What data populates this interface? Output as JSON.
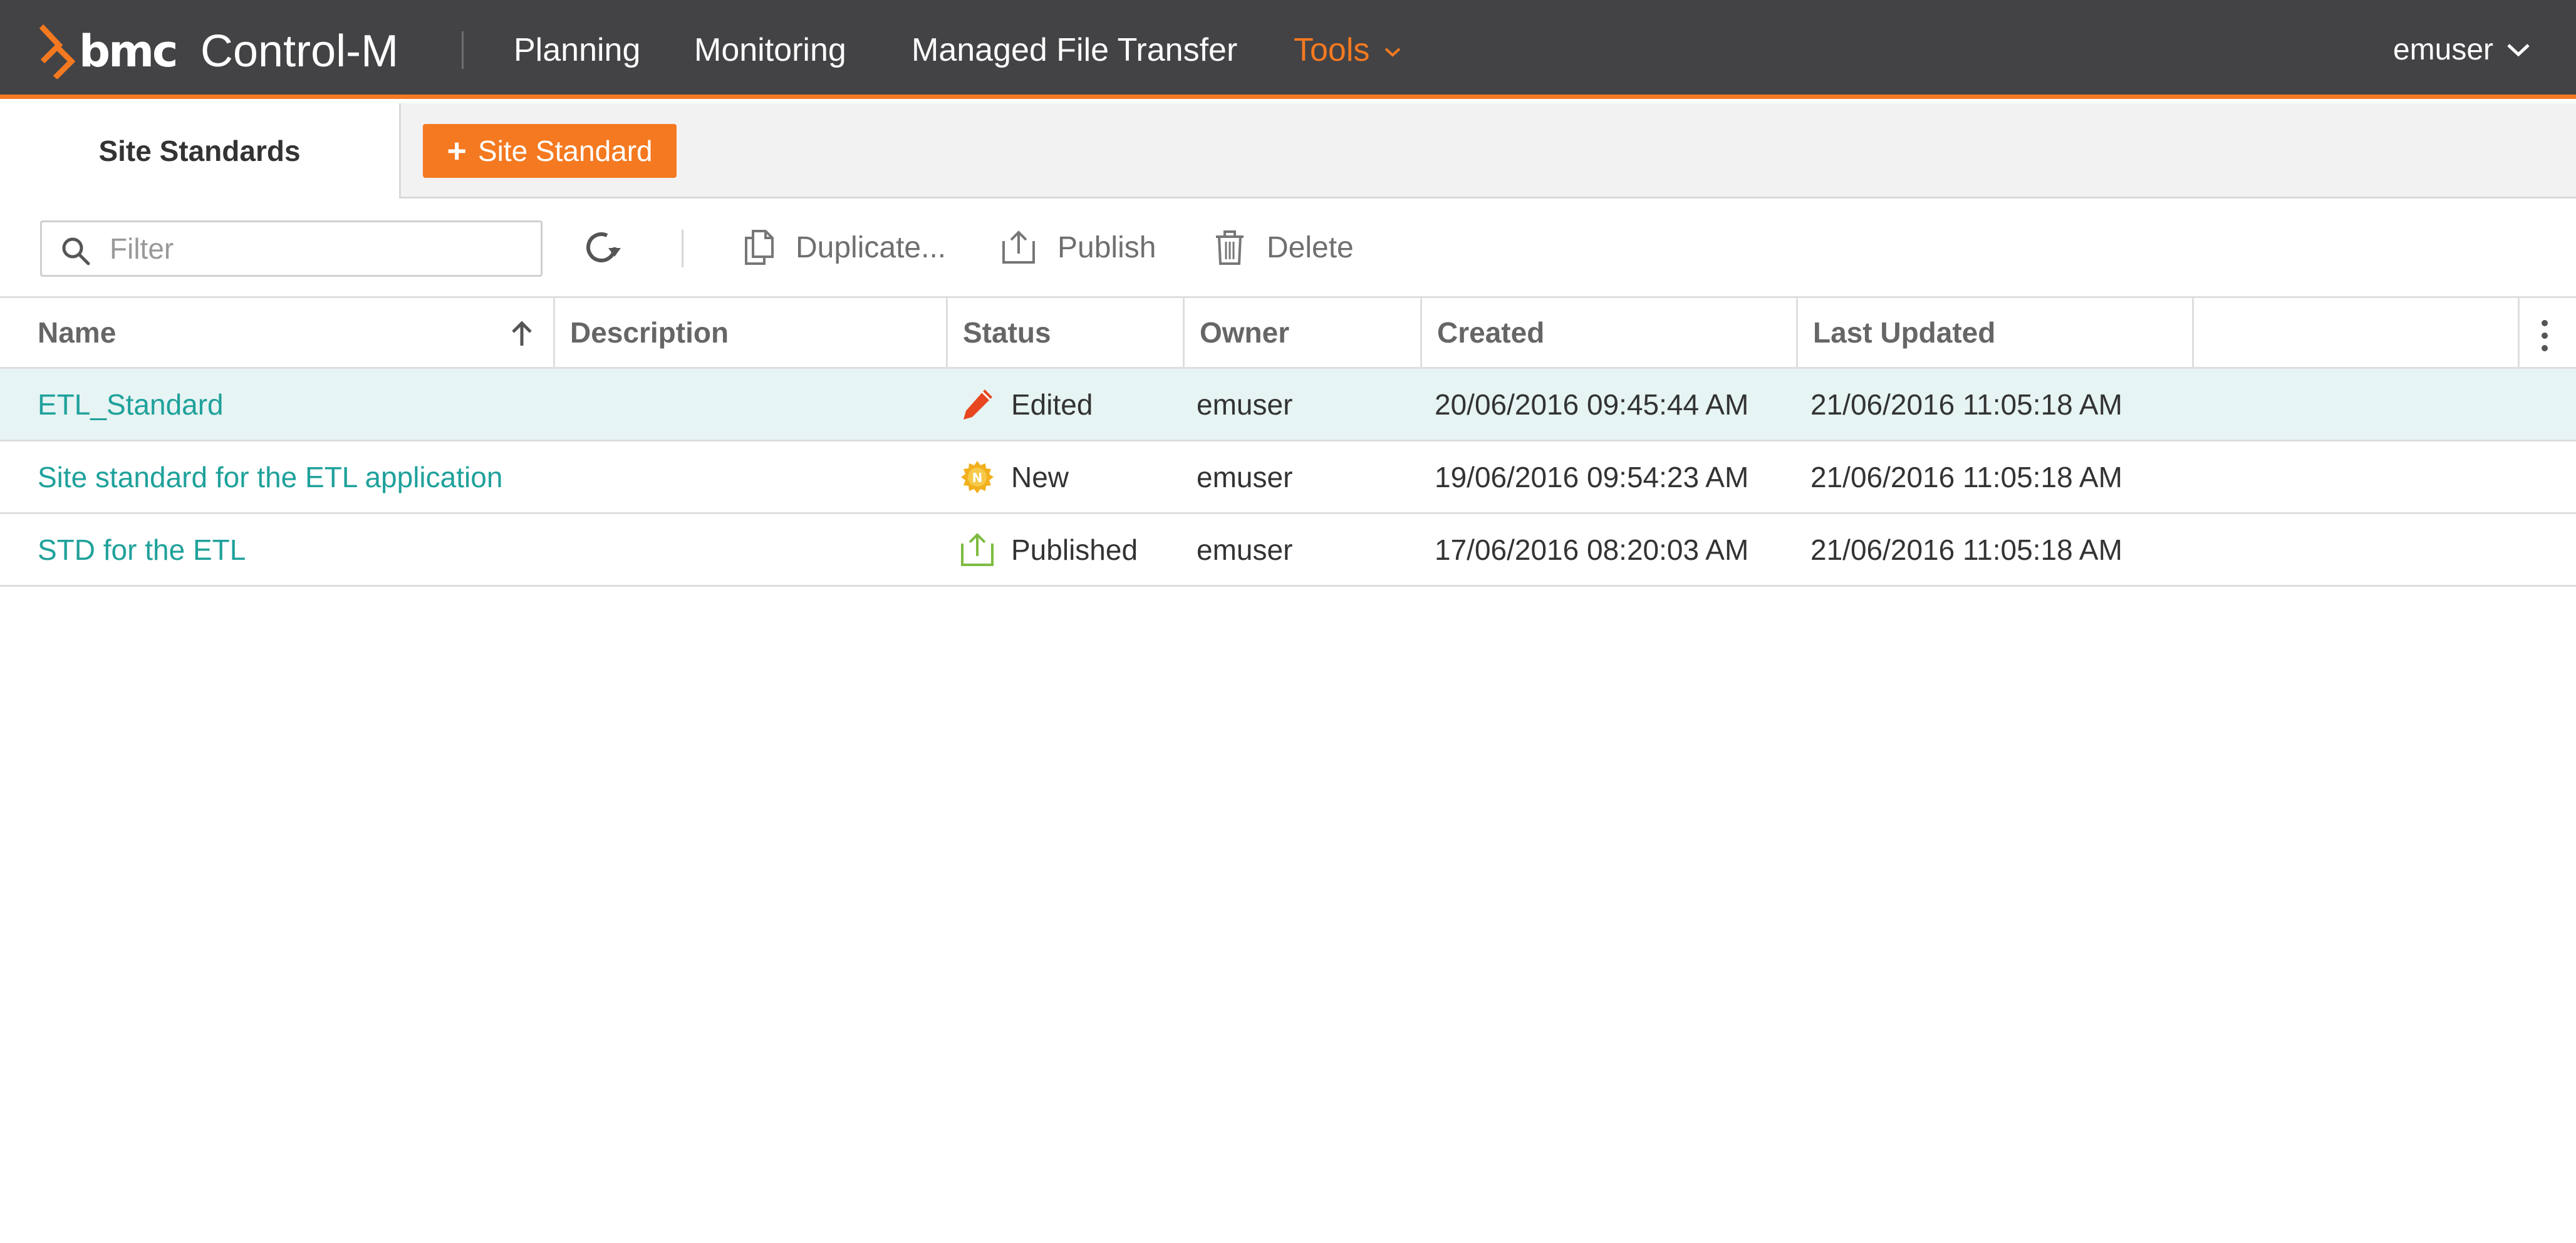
{
  "header": {
    "brand": "bmc",
    "product": "Control-M",
    "nav": [
      {
        "label": "Planning"
      },
      {
        "label": "Monitoring"
      },
      {
        "label": "Managed File Transfer"
      },
      {
        "label": "Tools"
      }
    ],
    "user": "emuser",
    "accent_color": "#f47920"
  },
  "tabs": {
    "active_label": "Site Standards",
    "add_button_label": "Site Standard"
  },
  "toolbar": {
    "filter_placeholder": "Filter",
    "duplicate_label": "Duplicate...",
    "publish_label": "Publish",
    "delete_label": "Delete"
  },
  "grid": {
    "columns": [
      "Name",
      "Description",
      "Status",
      "Owner",
      "Created",
      "Last Updated"
    ],
    "sort_column": "Name",
    "sort_direction": "ascending",
    "rows": [
      {
        "name": "ETL_Standard",
        "description": "",
        "status": "Edited",
        "status_icon": "pencil-icon",
        "owner": "emuser",
        "created": "20/06/2016 09:45:44 AM",
        "updated": "21/06/2016 11:05:18 AM",
        "selected": true
      },
      {
        "name": "Site standard for the ETL application",
        "description": "",
        "status": "New",
        "status_icon": "new-badge-icon",
        "owner": "emuser",
        "created": "19/06/2016 09:54:23 AM",
        "updated": "21/06/2016 11:05:18 AM",
        "selected": false
      },
      {
        "name": "STD for the ETL",
        "description": "",
        "status": "Published",
        "status_icon": "published-icon",
        "owner": "emuser",
        "created": "17/06/2016 08:20:03 AM",
        "updated": "21/06/2016 11:05:18 AM",
        "selected": false
      }
    ]
  }
}
